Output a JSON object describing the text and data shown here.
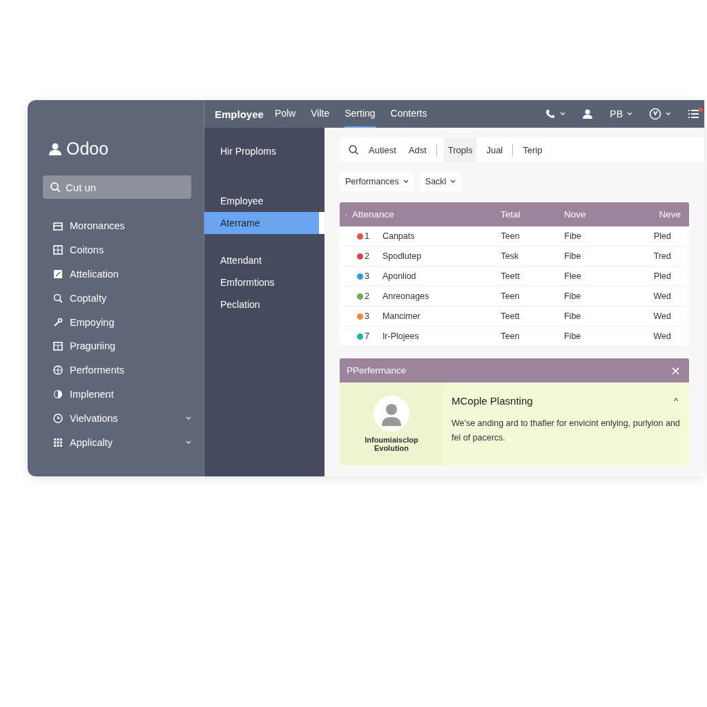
{
  "sidebar": {
    "brand": "Odoo",
    "search": {
      "placeholder": "Cut un"
    },
    "items": [
      {
        "label": "Moronances",
        "expandable": false
      },
      {
        "label": "Coitons",
        "expandable": false
      },
      {
        "label": "Attelication",
        "expandable": false
      },
      {
        "label": "Coptalty",
        "expandable": false
      },
      {
        "label": "Empoying",
        "expandable": false
      },
      {
        "label": "Praguriing",
        "expandable": false
      },
      {
        "label": "Performents",
        "expandable": false
      },
      {
        "label": "Implenent",
        "expandable": false
      },
      {
        "label": "Vielvations",
        "expandable": true
      },
      {
        "label": "Applicalty",
        "expandable": true
      }
    ]
  },
  "top_bar": {
    "brand": "Employee",
    "tabs": [
      {
        "label": "Polw",
        "selected": false
      },
      {
        "label": "Vilte",
        "selected": false
      },
      {
        "label": "Serting",
        "selected": true
      },
      {
        "label": "Conterts",
        "selected": false
      }
    ],
    "user_initials": "PB"
  },
  "submenu": {
    "groups": [
      [
        {
          "label": "Hir Proploms",
          "selected": false
        }
      ],
      [
        {
          "label": "Employee",
          "selected": false
        },
        {
          "label": "Aterrame",
          "selected": true
        }
      ],
      [
        {
          "label": "Attendant",
          "selected": false
        },
        {
          "label": "Emformtions",
          "selected": false
        },
        {
          "label": "Peclation",
          "selected": false
        }
      ]
    ]
  },
  "search_bar": {
    "terms": [
      {
        "label": "Autiest",
        "selected": false
      },
      {
        "label": "Adst",
        "selected": false
      },
      {
        "label": "Tropls",
        "selected": true
      },
      {
        "label": "Jual",
        "selected": false
      },
      {
        "label": "Terip",
        "selected": false
      }
    ]
  },
  "filters": [
    "Performances",
    "Sackl"
  ],
  "table": {
    "marker": "·",
    "columns": [
      "Attenance",
      "Tetal",
      "Nove",
      "Neve"
    ],
    "rows": [
      {
        "color": "#e0544f",
        "number": "1",
        "cells": [
          "Canpats",
          "Teen",
          "Fibe",
          "Pled"
        ]
      },
      {
        "color": "#d9434b",
        "number": "2",
        "cells": [
          "Spodlutep",
          "Tesk",
          "Fibe",
          "Tred"
        ]
      },
      {
        "color": "#2d9fe0",
        "number": "3",
        "cells": [
          "Aponliod",
          "Teett",
          "Flee",
          "Pled"
        ]
      },
      {
        "color": "#6ab04c",
        "number": "2",
        "cells": [
          "Anreonages",
          "Teen",
          "Fibe",
          "Wed"
        ]
      },
      {
        "color": "#ef8a3c",
        "number": "3",
        "cells": [
          "Mancimer",
          "Teett",
          "Fibe",
          "Wed"
        ]
      },
      {
        "color": "#1fb5a5",
        "number": "7",
        "cells": [
          "Ir-Plojees",
          "Teen",
          "Fibe",
          "Wed"
        ]
      }
    ]
  },
  "panel": {
    "title": "PPerfermance",
    "close": "×",
    "profile_caption": "Infoumiaisclop Evolution",
    "heading": "MCople Plasnting",
    "collapse": "^",
    "text": "We'se anding ard to thafier for envicint enlying, purlyion and fel of pacercs."
  }
}
